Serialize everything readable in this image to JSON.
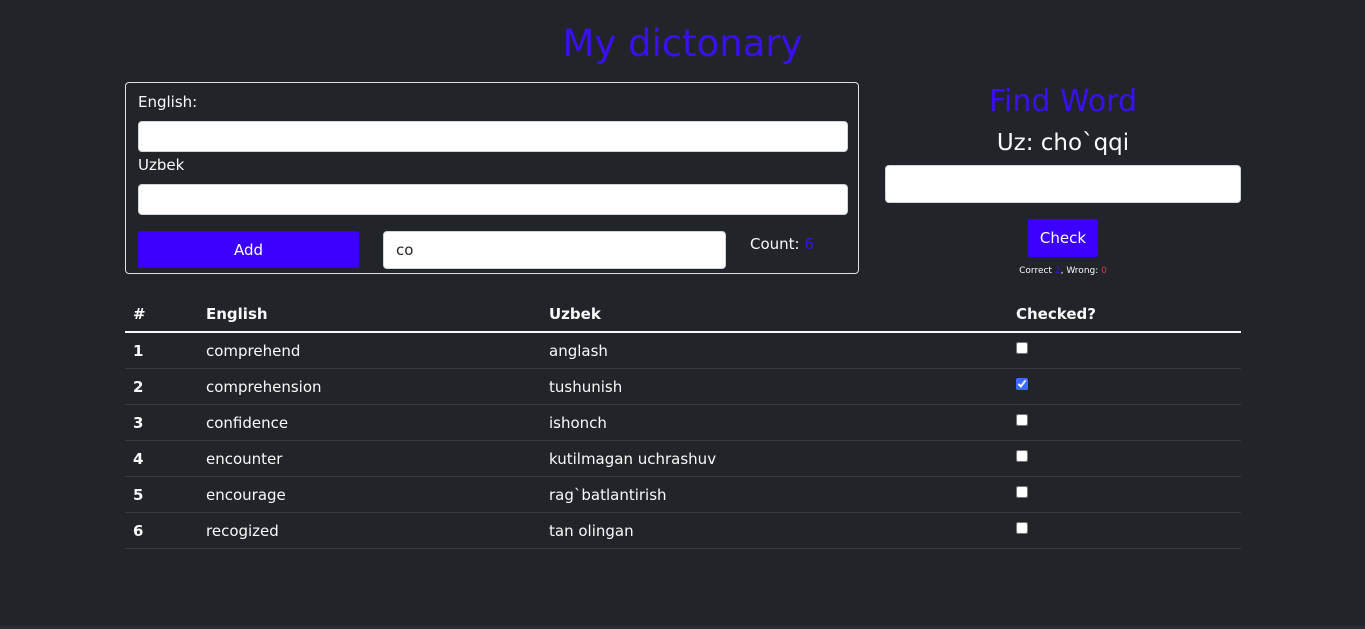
{
  "page": {
    "title": "My dictonary"
  },
  "form": {
    "english_label": "English:",
    "english_value": "",
    "uzbek_label": "Uzbek",
    "uzbek_value": "",
    "add_label": "Add",
    "filter_value": "co",
    "count_label": "Count:",
    "count_value": "6"
  },
  "find": {
    "title": "Find Word",
    "prompt": "Uz: cho`qqi",
    "answer_value": "",
    "check_label": "Check",
    "correct_label": "Correct",
    "correct_value": "2",
    "wrong_label": "Wrong:",
    "wrong_value": "0"
  },
  "table": {
    "headers": [
      "#",
      "English",
      "Uzbek",
      "Checked?"
    ],
    "rows": [
      {
        "num": "1",
        "english": "comprehend",
        "uzbek": "anglash",
        "checked": false
      },
      {
        "num": "2",
        "english": "comprehension",
        "uzbek": "tushunish",
        "checked": true
      },
      {
        "num": "3",
        "english": "confidence",
        "uzbek": "ishonch",
        "checked": false
      },
      {
        "num": "4",
        "english": "encounter",
        "uzbek": "kutilmagan uchrashuv",
        "checked": false
      },
      {
        "num": "5",
        "english": "encourage",
        "uzbek": "rag`batlantirish",
        "checked": false
      },
      {
        "num": "6",
        "english": "recogized",
        "uzbek": "tan olingan",
        "checked": false
      }
    ]
  },
  "colors": {
    "accent": "#3b0ff5",
    "button": "#3b00ff",
    "background": "#212529",
    "wrong": "#dc3545"
  }
}
